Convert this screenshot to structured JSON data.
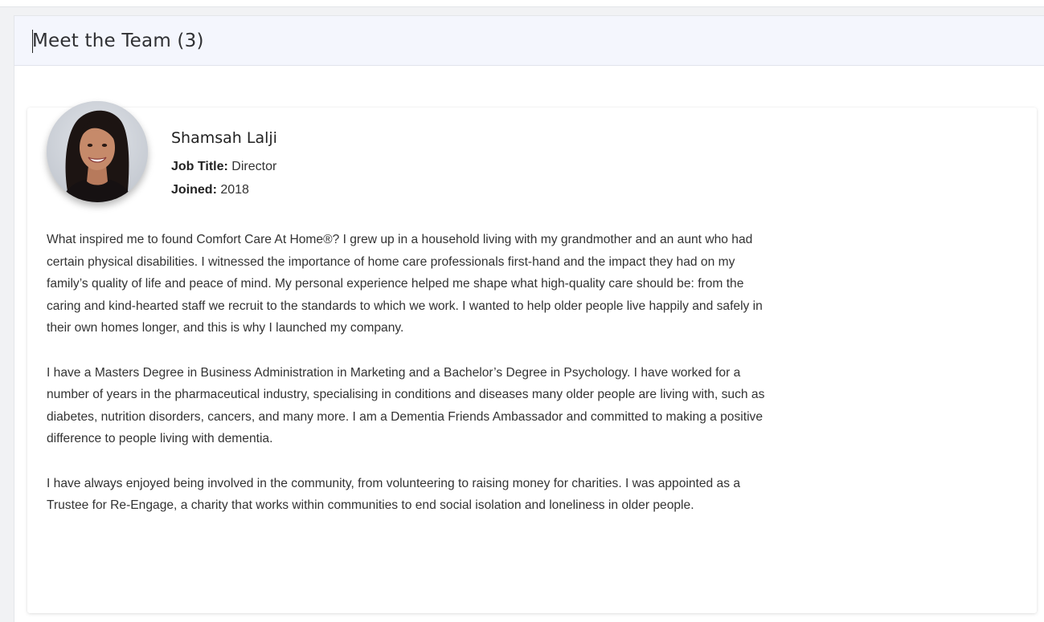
{
  "header": {
    "title": "Meet the Team (3)"
  },
  "member": {
    "name": "Shamsah Lalji",
    "job_title_label": "Job Title:",
    "job_title": "Director",
    "joined_label": "Joined:",
    "joined": "2018",
    "bio": [
      "What inspired me to found Comfort Care At Home®? I grew up in a household living with my grandmother and an aunt who had certain physical disabilities. I witnessed the importance of home care professionals first-hand and the impact they had on my family’s quality of life and peace of mind. My personal experience helped me shape what high-quality care should be: from the caring and kind-hearted staff we recruit to the standards to which we work. I wanted to help older people live happily and safely in their own homes longer, and this is why I launched my company.",
      "I have a Masters Degree in Business Administration in Marketing and a Bachelor’s Degree in Psychology. I have worked for a number of years in the pharmaceutical industry, specialising in conditions and diseases many older people are living with, such as diabetes, nutrition disorders, cancers, and many more. I am a Dementia Friends Ambassador and committed to making a positive difference to people living with dementia.",
      "I have always enjoyed being involved in the community, from volunteering to raising money for charities. I was appointed as a Trustee for Re-Engage, a charity that works within communities to end social isolation and loneliness in older people."
    ]
  },
  "colors": {
    "header_bg": "#f4f6fd",
    "page_bg": "#f1f2f4",
    "card_bg": "#ffffff",
    "text": "#333333"
  }
}
